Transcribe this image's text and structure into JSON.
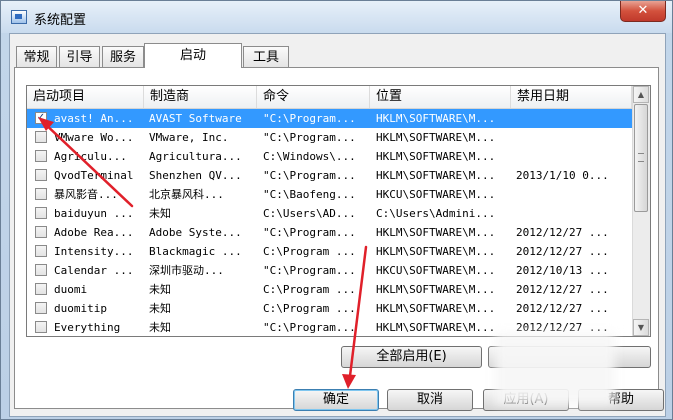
{
  "window": {
    "title": "系统配置",
    "close_glyph": "✕"
  },
  "tabs": [
    {
      "label": "常规",
      "active": false
    },
    {
      "label": "引导",
      "active": false
    },
    {
      "label": "服务",
      "active": false
    },
    {
      "label": "启动",
      "active": true
    },
    {
      "label": "工具",
      "active": false
    }
  ],
  "table": {
    "headers": [
      "启动项目",
      "制造商",
      "命令",
      "位置",
      "禁用日期"
    ],
    "rows": [
      {
        "checked": true,
        "selected": true,
        "item": "avast! An...",
        "maker": "AVAST Software",
        "command": "\"C:\\Program...",
        "location": "HKLM\\SOFTWARE\\M...",
        "date": ""
      },
      {
        "checked": false,
        "selected": false,
        "item": "VMware Wo...",
        "maker": "VMware, Inc.",
        "command": "\"C:\\Program...",
        "location": "HKLM\\SOFTWARE\\M...",
        "date": ""
      },
      {
        "checked": false,
        "selected": false,
        "item": "Agriculu...",
        "maker": "Agricultura...",
        "command": "C:\\Windows\\...",
        "location": "HKLM\\SOFTWARE\\M...",
        "date": ""
      },
      {
        "checked": false,
        "selected": false,
        "item": "QvodTerminal",
        "maker": "Shenzhen QV...",
        "command": "\"C:\\Program...",
        "location": "HKLM\\SOFTWARE\\M...",
        "date": "2013/1/10 0..."
      },
      {
        "checked": false,
        "selected": false,
        "item": "暴风影音...",
        "maker": "北京暴风科...",
        "command": "\"C:\\Baofeng...",
        "location": "HKCU\\SOFTWARE\\M...",
        "date": ""
      },
      {
        "checked": false,
        "selected": false,
        "item": "baiduyun ...",
        "maker": "未知",
        "command": "C:\\Users\\AD...",
        "location": "C:\\Users\\Admini...",
        "date": ""
      },
      {
        "checked": false,
        "selected": false,
        "item": "Adobe Rea...",
        "maker": "Adobe Syste...",
        "command": "\"C:\\Program...",
        "location": "HKLM\\SOFTWARE\\M...",
        "date": "2012/12/27 ..."
      },
      {
        "checked": false,
        "selected": false,
        "item": "Intensity...",
        "maker": "Blackmagic ...",
        "command": "C:\\Program ...",
        "location": "HKLM\\SOFTWARE\\M...",
        "date": "2012/12/27 ..."
      },
      {
        "checked": false,
        "selected": false,
        "item": "Calendar ...",
        "maker": "深圳市驱动...",
        "command": "\"C:\\Program...",
        "location": "HKCU\\SOFTWARE\\M...",
        "date": "2012/10/13 ..."
      },
      {
        "checked": false,
        "selected": false,
        "item": "duomi",
        "maker": "未知",
        "command": "C:\\Program ...",
        "location": "HKLM\\SOFTWARE\\M...",
        "date": "2012/12/27 ..."
      },
      {
        "checked": false,
        "selected": false,
        "item": "duomitip",
        "maker": "未知",
        "command": "C:\\Program ...",
        "location": "HKLM\\SOFTWARE\\M...",
        "date": "2012/12/27 ..."
      },
      {
        "checked": false,
        "selected": false,
        "item": "Everything",
        "maker": "未知",
        "command": "\"C:\\Program...",
        "location": "HKLM\\SOFTWARE\\M...",
        "date": "2012/12/27 ..."
      }
    ]
  },
  "buttons": {
    "enable_all": "全部启用(E)",
    "ok": "确定",
    "cancel": "取消",
    "apply": "应用(A)",
    "help": "帮助"
  },
  "colors": {
    "selection": "#3399ff",
    "annotation_arrow": "#e0202a"
  }
}
